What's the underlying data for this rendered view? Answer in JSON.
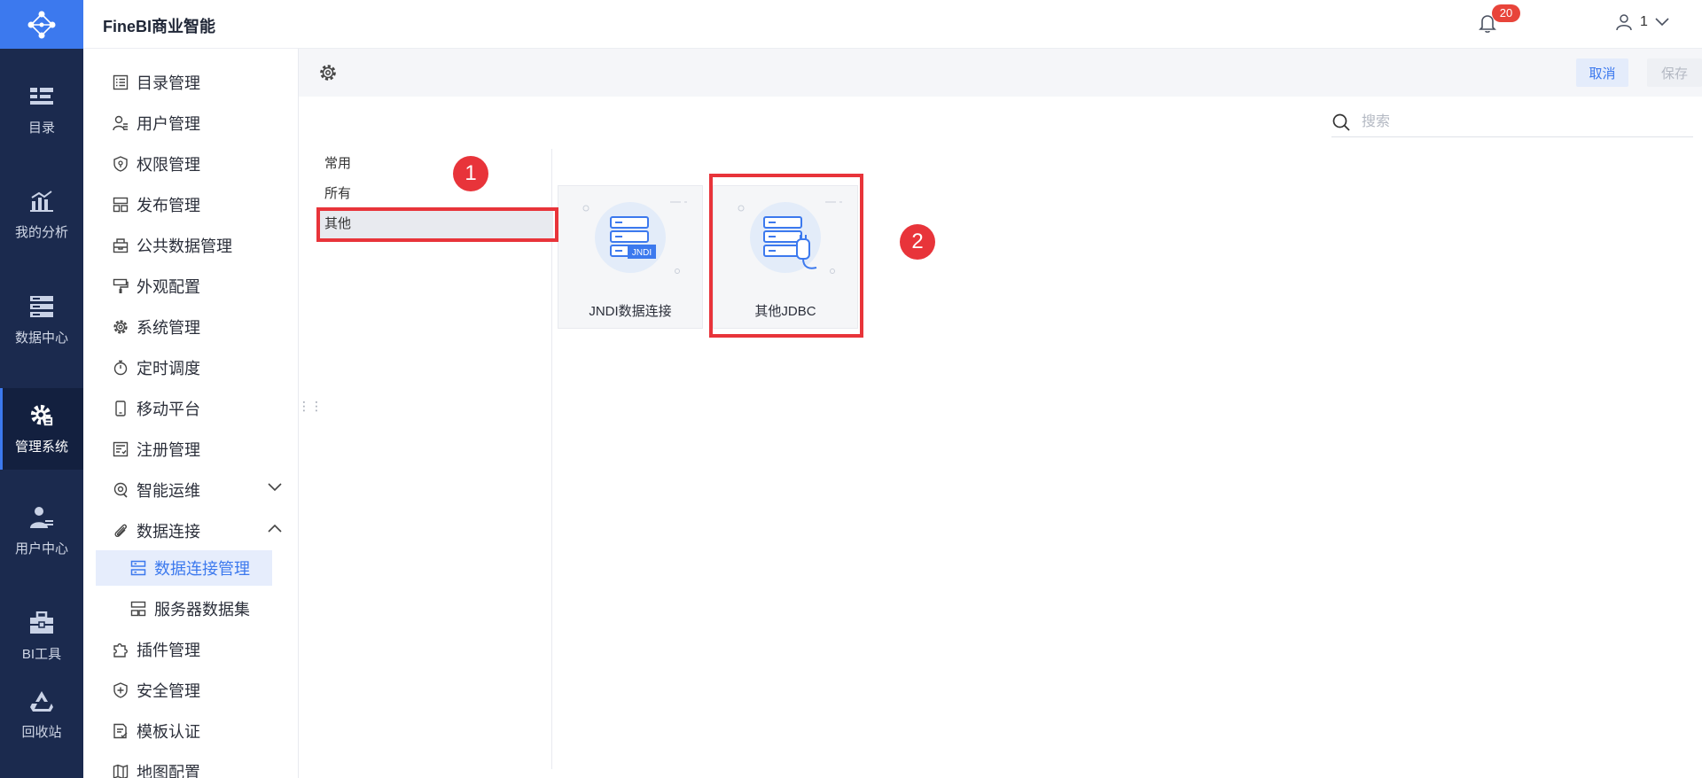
{
  "app": {
    "title": "FineBI商业智能"
  },
  "rail": {
    "items": [
      {
        "label": "目录",
        "icon": "catalog-icon"
      },
      {
        "label": "我的分析",
        "icon": "analysis-icon"
      },
      {
        "label": "数据中心",
        "icon": "data-center-icon"
      },
      {
        "label": "管理系统",
        "icon": "admin-gear-icon"
      },
      {
        "label": "用户中心",
        "icon": "user-center-icon"
      },
      {
        "label": "BI工具",
        "icon": "toolbox-icon"
      },
      {
        "label": "回收站",
        "icon": "recycle-icon"
      }
    ],
    "active": "管理系统"
  },
  "header": {
    "notification_count": "20",
    "user_name": "1"
  },
  "menu": {
    "items": [
      {
        "label": "目录管理",
        "icon": "list-icon"
      },
      {
        "label": "用户管理",
        "icon": "user-icon"
      },
      {
        "label": "权限管理",
        "icon": "shield-icon"
      },
      {
        "label": "发布管理",
        "icon": "publish-icon"
      },
      {
        "label": "公共数据管理",
        "icon": "database-icon"
      },
      {
        "label": "外观配置",
        "icon": "brush-icon"
      },
      {
        "label": "系统管理",
        "icon": "gear-icon"
      },
      {
        "label": "定时调度",
        "icon": "timer-icon"
      },
      {
        "label": "移动平台",
        "icon": "mobile-icon"
      },
      {
        "label": "注册管理",
        "icon": "register-icon"
      },
      {
        "label": "智能运维",
        "icon": "ops-icon"
      },
      {
        "label": "数据连接",
        "icon": "link-icon"
      },
      {
        "label": "数据连接管理",
        "icon": "connection-icon"
      },
      {
        "label": "服务器数据集",
        "icon": "server-dataset-icon"
      },
      {
        "label": "插件管理",
        "icon": "plugin-icon"
      },
      {
        "label": "安全管理",
        "icon": "security-icon"
      },
      {
        "label": "模板认证",
        "icon": "template-icon"
      },
      {
        "label": "地图配置",
        "icon": "map-icon"
      }
    ],
    "active": "数据连接管理"
  },
  "toolbar": {
    "cancel_label": "取消",
    "save_label": "保存"
  },
  "search": {
    "placeholder": "搜索",
    "value": ""
  },
  "categories": [
    "常用",
    "所有",
    "其他"
  ],
  "active_category": "其他",
  "cards": [
    {
      "label": "JNDI数据连接",
      "badge": "JNDI"
    },
    {
      "label": "其他JDBC"
    }
  ],
  "annotations": [
    "1",
    "2"
  ],
  "colors": {
    "accent": "#3c79ee",
    "rail": "#1b2a4e",
    "highlight": "#e8343a",
    "badge": "#e8443a"
  }
}
